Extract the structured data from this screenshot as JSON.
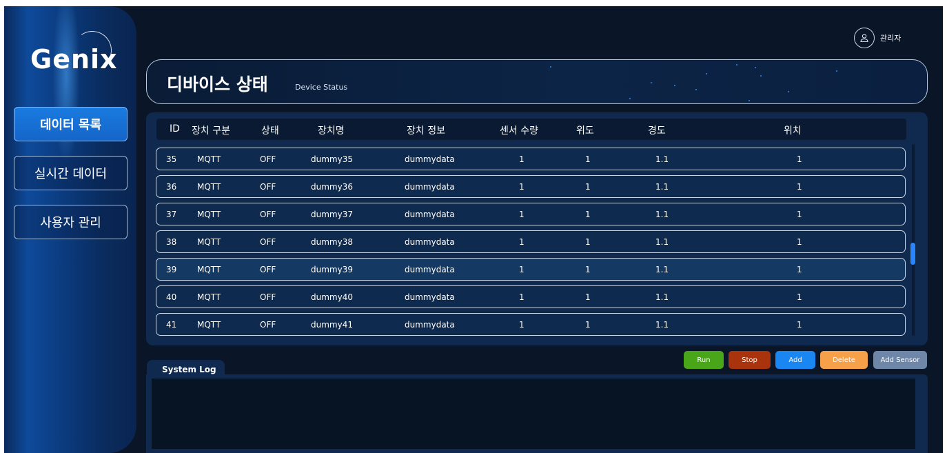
{
  "sidebar": {
    "logo": "Genix",
    "items": [
      {
        "label": "데이터 목록",
        "active": true
      },
      {
        "label": "실시간 데이터",
        "active": false
      },
      {
        "label": "사용자 관리",
        "active": false
      }
    ]
  },
  "header": {
    "user_icon": "user-icon",
    "user_name": "관리자"
  },
  "banner": {
    "title": "디바이스 상태",
    "subtitle": "Device Status"
  },
  "table": {
    "columns": [
      "ID",
      "장치 구분",
      "상태",
      "장치명",
      "장치 정보",
      "센서 수량",
      "위도",
      "경도",
      "위치"
    ],
    "rows": [
      [
        "35",
        "MQTT",
        "OFF",
        "dummy35",
        "dummydata",
        "1",
        "1",
        "1.1",
        "1"
      ],
      [
        "36",
        "MQTT",
        "OFF",
        "dummy36",
        "dummydata",
        "1",
        "1",
        "1.1",
        "1"
      ],
      [
        "37",
        "MQTT",
        "OFF",
        "dummy37",
        "dummydata",
        "1",
        "1",
        "1.1",
        "1"
      ],
      [
        "38",
        "MQTT",
        "OFF",
        "dummy38",
        "dummydata",
        "1",
        "1",
        "1.1",
        "1"
      ],
      [
        "39",
        "MQTT",
        "OFF",
        "dummy39",
        "dummydata",
        "1",
        "1",
        "1.1",
        "1"
      ],
      [
        "40",
        "MQTT",
        "OFF",
        "dummy40",
        "dummydata",
        "1",
        "1",
        "1.1",
        "1"
      ],
      [
        "41",
        "MQTT",
        "OFF",
        "dummy41",
        "dummydata",
        "1",
        "1",
        "1.1",
        "1"
      ]
    ],
    "highlighted_row": 4,
    "scroll_position": 0.5
  },
  "actions": [
    {
      "label": "Run",
      "color": "#4aa619"
    },
    {
      "label": "Stop",
      "color": "#a8330c"
    },
    {
      "label": "Add",
      "color": "#1a86f2"
    },
    {
      "label": "Delete",
      "color": "#f7a04a"
    },
    {
      "label": "Add Sensor",
      "color": "#6e86a8"
    }
  ],
  "log": {
    "tab_label": "System Log"
  }
}
